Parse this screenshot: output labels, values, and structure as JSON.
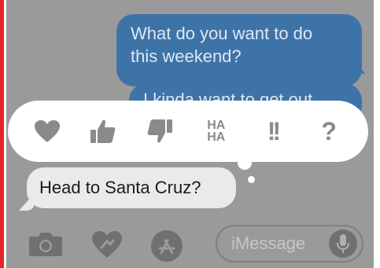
{
  "conversation": {
    "sent_message_1": {
      "line_1": "What do you want to do",
      "line_2": "this weekend?"
    },
    "sent_message_2": "I kinda want to get out",
    "received_message": "Head to Santa Cruz?"
  },
  "tapback_menu": {
    "options": [
      "heart",
      "thumbs-up",
      "thumbs-down",
      "haha",
      "exclamation",
      "question"
    ],
    "haha_line_1": "HA",
    "haha_line_2": "HA",
    "exclamation_label": "!!",
    "question_label": "?"
  },
  "composer": {
    "placeholder": "iMessage"
  },
  "colors": {
    "sent_bubble": "#3e73a8",
    "dimmed_background": "#9a9a9a",
    "tapback_icon": "#8a8a8a",
    "accent_bar": "#e5232b"
  }
}
